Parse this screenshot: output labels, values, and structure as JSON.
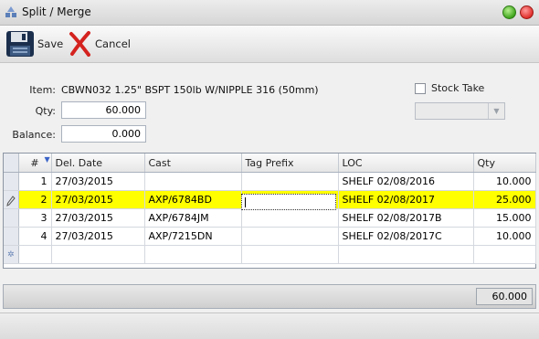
{
  "window": {
    "title": "Split / Merge"
  },
  "toolbar": {
    "save_label": "Save",
    "cancel_label": "Cancel"
  },
  "form": {
    "item_label": "Item:",
    "item_value": "CBWN032 1.25\" BSPT 150lb W/NIPPLE 316 (50mm)",
    "qty_label": "Qty:",
    "qty_value": "60.000",
    "balance_label": "Balance:",
    "balance_value": "0.000",
    "stock_take_label": "Stock Take",
    "stock_take_checked": false,
    "dropdown_value": ""
  },
  "grid": {
    "columns": [
      "#",
      "Del. Date",
      "Cast",
      "Tag Prefix",
      "LOC",
      "Qty"
    ],
    "rows": [
      {
        "num": "1",
        "date": "27/03/2015",
        "cast": "",
        "tag": "",
        "loc": "SHELF 02/08/2016",
        "qty": "10.000"
      },
      {
        "num": "2",
        "date": "27/03/2015",
        "cast": "AXP/6784BD",
        "tag": "",
        "loc": "SHELF 02/08/2017",
        "qty": "25.000"
      },
      {
        "num": "3",
        "date": "27/03/2015",
        "cast": "AXP/6784JM",
        "tag": "",
        "loc": "SHELF 02/08/2017B",
        "qty": "15.000"
      },
      {
        "num": "4",
        "date": "27/03/2015",
        "cast": "AXP/7215DN",
        "tag": "",
        "loc": "SHELF 02/08/2017C",
        "qty": "10.000"
      }
    ],
    "selected_row": 2
  },
  "footer": {
    "total": "60.000"
  },
  "colors": {
    "selected_row": "#ffff00",
    "header_bg": "#e6e6e6"
  },
  "icons": {
    "save": "floppy-disk-icon",
    "cancel": "red-x-icon",
    "app": "split-merge-icon"
  }
}
